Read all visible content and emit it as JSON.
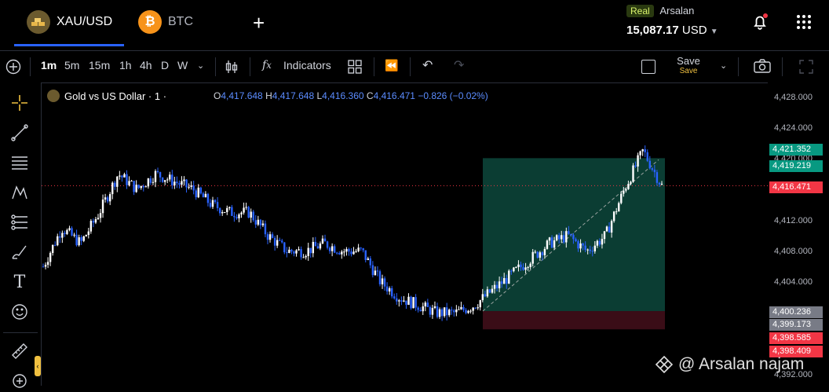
{
  "tabs": [
    {
      "label": "XAU/USD",
      "icon": "gold-bars-icon"
    },
    {
      "label": "BTC",
      "icon": "bitcoin-icon"
    }
  ],
  "account": {
    "mode": "Real",
    "name": "Arsalan",
    "balance": "15,087.17",
    "currency": "USD"
  },
  "toolbar": {
    "intervals": [
      "1m",
      "5m",
      "15m",
      "1h",
      "4h",
      "D",
      "W"
    ],
    "active_interval": "1m",
    "indicators_label": "Indicators",
    "save_label": "Save",
    "save_sub": "Save"
  },
  "legend": {
    "title": "Gold vs US Dollar · 1 ·",
    "o_label": "O",
    "o": "4,417.648",
    "h_label": "H",
    "h": "4,417.648",
    "l_label": "L",
    "l": "4,416.360",
    "c_label": "C",
    "c": "4,416.471",
    "change": "−0.826 (−0.02%)"
  },
  "price_axis": {
    "ticks": [
      "4,428.000",
      "4,424.000",
      "4,420.000",
      "4,412.000",
      "4,408.000",
      "4,404.000",
      "4,392.000"
    ],
    "labels": [
      {
        "text": "4,421.352",
        "color": "#089981"
      },
      {
        "text": "4,419.219",
        "color": "#089981"
      },
      {
        "text": "4,416.471",
        "color": "#f23645"
      },
      {
        "text": "4,400.236",
        "color": "#787b86"
      },
      {
        "text": "4,399.173",
        "color": "#787b86"
      },
      {
        "text": "4,398.585",
        "color": "#f23645"
      },
      {
        "text": "4,398.409",
        "color": "#f23645"
      }
    ]
  },
  "watermark": "@ Arsalan najam",
  "colors": {
    "up": "#ffffff",
    "down": "#2962ff",
    "profit_zone": "#0b3d33",
    "loss_zone": "#3a0d17",
    "accent": "#2962ff"
  },
  "chart_data": {
    "type": "candlestick",
    "symbol": "XAU/USD",
    "interval": "1m",
    "ylim": [
      4392,
      4428
    ],
    "last_price": 4416.471,
    "approx_close_path": [
      4406,
      4411,
      4409,
      4413,
      4418,
      4416,
      4418,
      4417,
      4416,
      4414,
      4413,
      4413,
      4410,
      4408,
      4408,
      4409,
      4408,
      4408,
      4404,
      4402,
      4401,
      4400,
      4400,
      4401,
      4403,
      4405,
      4407,
      4409,
      4410,
      4408,
      4410,
      4416,
      4421,
      4416.471
    ],
    "position": {
      "entry": 4400.236,
      "take_profit": 4419.219,
      "stop_loss": 4398.585
    }
  }
}
